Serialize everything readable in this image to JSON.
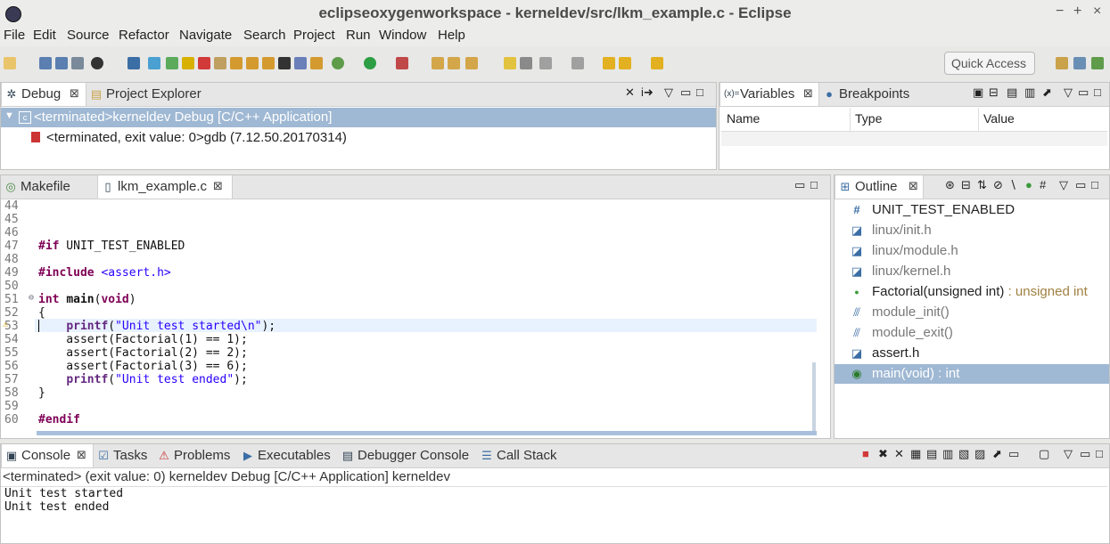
{
  "window": {
    "title": "eclipseoxygenworkspace - kerneldev/src/lkm_example.c - Eclipse",
    "controls": [
      "−",
      "+",
      "×"
    ]
  },
  "menu": [
    "File",
    "Edit",
    "Source",
    "Refactor",
    "Navigate",
    "Search",
    "Project",
    "Run",
    "Window",
    "Help"
  ],
  "toolbar": {
    "quick_access_placeholder": "Quick Access"
  },
  "debug_view": {
    "tabs": [
      {
        "label": "Debug",
        "icon": "debug-icon"
      },
      {
        "label": "Project Explorer",
        "icon": "project-explorer-icon"
      }
    ],
    "rows": [
      "<terminated>kerneldev Debug [C/C++ Application]",
      "<terminated, exit value: 0>gdb (7.12.50.20170314)"
    ]
  },
  "variables_view": {
    "tabs": [
      {
        "label": "Variables",
        "icon": "variables-icon"
      },
      {
        "label": "Breakpoints",
        "icon": "breakpoints-icon"
      }
    ],
    "columns": [
      "Name",
      "Type",
      "Value"
    ]
  },
  "editor": {
    "tabs": [
      {
        "label": "Makefile",
        "icon": "makefile-icon"
      },
      {
        "label": "lkm_example.c",
        "icon": "c-file-icon"
      }
    ],
    "lines": [
      {
        "n": "44",
        "text": ""
      },
      {
        "n": "45",
        "text": ""
      },
      {
        "n": "46",
        "text": ""
      },
      {
        "n": "47",
        "text": "#if UNIT_TEST_ENABLED"
      },
      {
        "n": "48",
        "text": ""
      },
      {
        "n": "49",
        "text": "#include <assert.h>"
      },
      {
        "n": "50",
        "text": ""
      },
      {
        "n": "51",
        "text": "int main(void)"
      },
      {
        "n": "52",
        "text": "{"
      },
      {
        "n": "53",
        "text": "    printf(\"Unit test started\\n\");"
      },
      {
        "n": "54",
        "text": "    assert(Factorial(1) == 1);"
      },
      {
        "n": "55",
        "text": "    assert(Factorial(2) == 2);"
      },
      {
        "n": "56",
        "text": "    assert(Factorial(3) == 6);"
      },
      {
        "n": "57",
        "text": "    printf(\"Unit test ended\");"
      },
      {
        "n": "58",
        "text": "}"
      },
      {
        "n": "59",
        "text": ""
      },
      {
        "n": "60",
        "text": "#endif"
      }
    ]
  },
  "outline_view": {
    "tab": "Outline",
    "items": [
      {
        "icon": "hash-icon",
        "label": "UNIT_TEST_ENABLED",
        "type": "",
        "dim": false
      },
      {
        "icon": "include-icon",
        "label": "linux/init.h",
        "type": "",
        "dim": true
      },
      {
        "icon": "include-icon",
        "label": "linux/module.h",
        "type": "",
        "dim": true
      },
      {
        "icon": "include-icon",
        "label": "linux/kernel.h",
        "type": "",
        "dim": true
      },
      {
        "icon": "function-icon",
        "label": "Factorial(unsigned int)",
        "type": " : unsigned int",
        "dim": false
      },
      {
        "icon": "macro-call-icon",
        "label": "module_init()",
        "type": "",
        "dim": true
      },
      {
        "icon": "macro-call-icon",
        "label": "module_exit()",
        "type": "",
        "dim": true
      },
      {
        "icon": "include-icon",
        "label": "assert.h",
        "type": "",
        "dim": false
      },
      {
        "icon": "function-icon",
        "label": "main(void) : int",
        "type": "",
        "dim": false,
        "selected": true
      }
    ]
  },
  "console_view": {
    "tabs": [
      {
        "label": "Console",
        "icon": "console-icon"
      },
      {
        "label": "Tasks",
        "icon": "tasks-icon"
      },
      {
        "label": "Problems",
        "icon": "problems-icon"
      },
      {
        "label": "Executables",
        "icon": "executables-icon"
      },
      {
        "label": "Debugger Console",
        "icon": "debugger-console-icon"
      },
      {
        "label": "Call Stack",
        "icon": "call-stack-icon"
      }
    ],
    "status": "<terminated> (exit value: 0) kerneldev Debug [C/C++ Application] kerneldev",
    "output": [
      "Unit test started",
      "Unit test ended"
    ]
  },
  "colors": {
    "selection": "#9fb8d3",
    "keyword": "#7f0055",
    "string": "#2a00ff"
  }
}
